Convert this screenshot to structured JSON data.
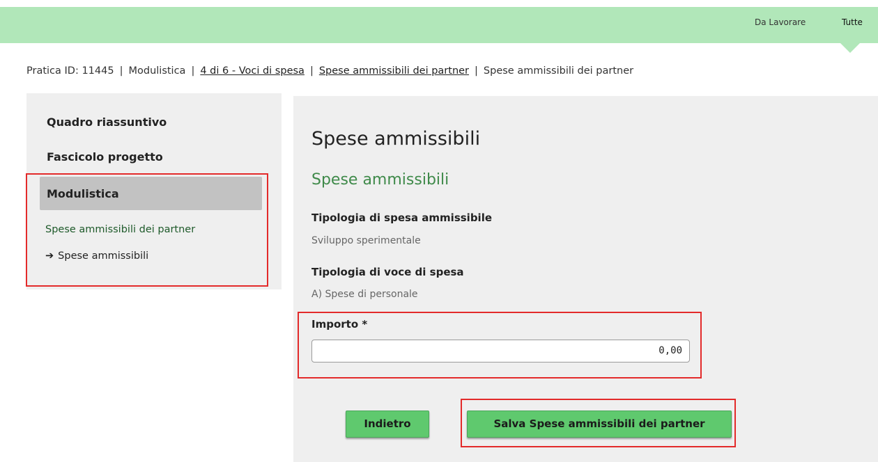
{
  "topbar": {
    "tabs": [
      "Da Lavorare",
      "Tutte"
    ]
  },
  "breadcrumb": {
    "pratica": "Pratica ID: 11445",
    "modulistica": "Modulistica",
    "step": "4 di 6 - Voci di spesa",
    "partner_link": "Spese ammissibili dei partner",
    "current": "Spese ammissibili dei partner",
    "separator": "|"
  },
  "sidebar": {
    "items": [
      "Quadro riassuntivo",
      "Fascicolo progetto",
      "Modulistica"
    ],
    "sub_item": "Spese ammissibili dei partner",
    "sub_sub_item": "Spese ammissibili",
    "arrow": "➔"
  },
  "main": {
    "title": "Spese ammissibili",
    "subtitle": "Spese ammissibili",
    "fields": [
      {
        "label": "Tipologia di spesa ammissibile",
        "value": "Sviluppo sperimentale"
      },
      {
        "label": "Tipologia di voce di spesa",
        "value": "A) Spese di personale"
      }
    ],
    "importo": {
      "label": "Importo *",
      "value": "0,00"
    }
  },
  "buttons": {
    "back": "Indietro",
    "save": "Salva Spese ammissibili dei partner"
  },
  "colors": {
    "topbar": "#b1e7b9",
    "accent_green": "#3f8a4a",
    "button_green": "#5fc96e",
    "highlight_red": "#e32a2a"
  }
}
